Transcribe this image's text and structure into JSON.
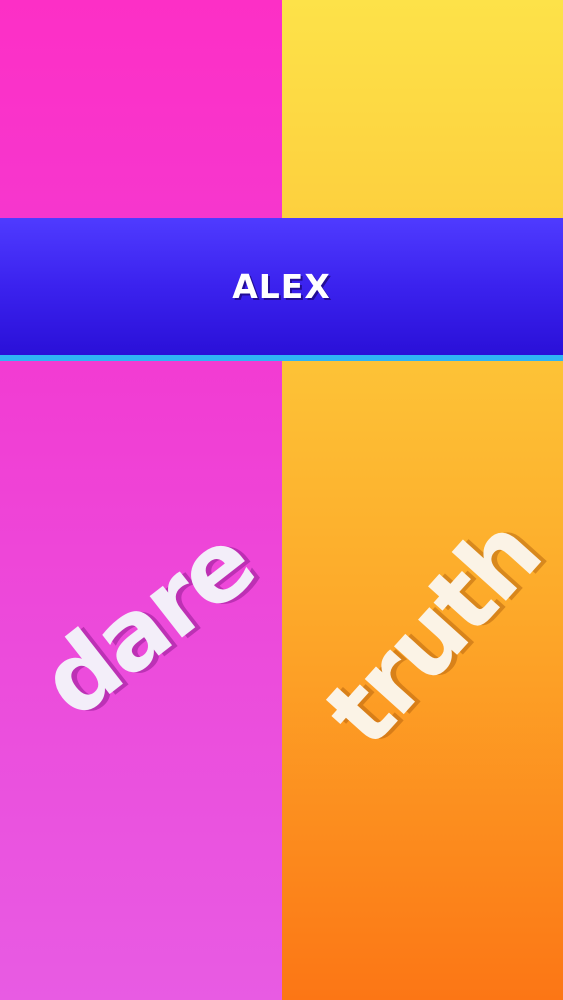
{
  "player": {
    "name": "ALEX"
  },
  "choices": {
    "dare": {
      "label": "dare"
    },
    "truth": {
      "label": "truth"
    }
  },
  "colors": {
    "dare_top": "#fd2fc6",
    "dare_bottom": "#e85be3",
    "truth_top": "#fde249",
    "truth_bottom": "#fc7615",
    "banner": "#3b22ee",
    "banner_stripe": "#2fb4f4",
    "text": "#ffffff"
  }
}
